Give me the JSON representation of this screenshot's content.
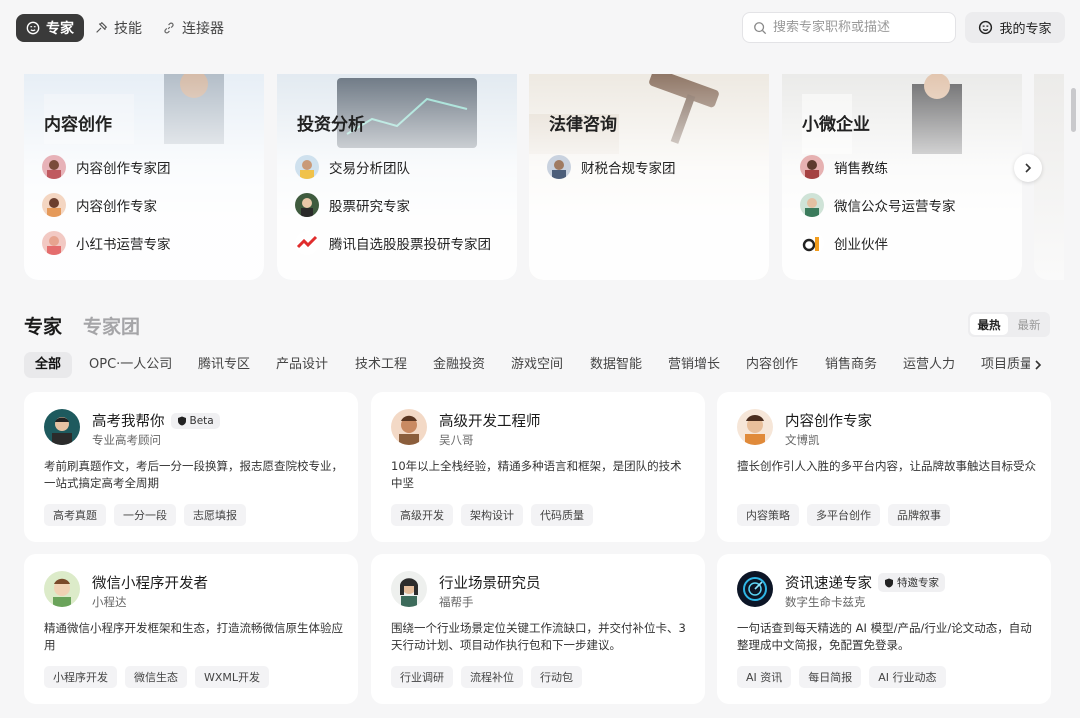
{
  "nav": {
    "tabs": [
      {
        "label": "专家",
        "icon": "expert-icon"
      },
      {
        "label": "技能",
        "icon": "skill-icon"
      },
      {
        "label": "连接器",
        "icon": "link-icon"
      }
    ],
    "search_placeholder": "搜索专家职称或描述",
    "my_experts_label": "我的专家"
  },
  "categories": [
    {
      "title": "内容创作",
      "items": [
        "内容创作专家团",
        "内容创作专家",
        "小红书运营专家"
      ]
    },
    {
      "title": "投资分析",
      "items": [
        "交易分析团队",
        "股票研究专家",
        "腾讯自选股股票投研专家团"
      ]
    },
    {
      "title": "法律咨询",
      "items": [
        "财税合规专家团"
      ]
    },
    {
      "title": "小微企业",
      "items": [
        "销售教练",
        "微信公众号运营专家",
        "创业伙伴"
      ]
    }
  ],
  "section": {
    "tabs": [
      "专家",
      "专家团"
    ],
    "sort": [
      "最热",
      "最新"
    ]
  },
  "filters": [
    "全部",
    "OPC·一人公司",
    "腾讯专区",
    "产品设计",
    "技术工程",
    "金融投资",
    "游戏空间",
    "数据智能",
    "营销增长",
    "内容创作",
    "销售商务",
    "运营人力",
    "项目质量"
  ],
  "experts": [
    {
      "name": "高考我帮你",
      "badge": "Beta",
      "subtitle": "专业高考顾问",
      "desc": "考前刷真题作文，考后一分一段换算，报志愿查院校专业，一站式搞定高考全周期",
      "tags": [
        "高考真题",
        "一分一段",
        "志愿填报"
      ]
    },
    {
      "name": "高级开发工程师",
      "badge": "",
      "subtitle": "吴八哥",
      "desc": "10年以上全栈经验，精通多种语言和框架，是团队的技术中坚",
      "tags": [
        "高级开发",
        "架构设计",
        "代码质量"
      ]
    },
    {
      "name": "内容创作专家",
      "badge": "",
      "subtitle": "文博凯",
      "desc": "擅长创作引人入胜的多平台内容，让品牌故事触达目标受众",
      "tags": [
        "内容策略",
        "多平台创作",
        "品牌叙事"
      ]
    },
    {
      "name": "微信小程序开发者",
      "badge": "",
      "subtitle": "小程达",
      "desc": "精通微信小程序开发框架和生态，打造流畅微信原生体验应用",
      "tags": [
        "小程序开发",
        "微信生态",
        "WXML开发"
      ]
    },
    {
      "name": "行业场景研究员",
      "badge": "",
      "subtitle": "福帮手",
      "desc": "围绕一个行业场景定位关键工作流缺口，并交付补位卡、3天行动计划、项目动作执行包和下一步建议。",
      "tags": [
        "行业调研",
        "流程补位",
        "行动包"
      ]
    },
    {
      "name": "资讯速递专家",
      "badge": "特邀专家",
      "subtitle": "数字生命卡兹克",
      "desc": "一句话查到每天精选的 AI 模型/产品/行业/论文动态，自动整理成中文简报，免配置免登录。",
      "tags": [
        "AI 资讯",
        "每日简报",
        "AI 行业动态"
      ]
    }
  ]
}
